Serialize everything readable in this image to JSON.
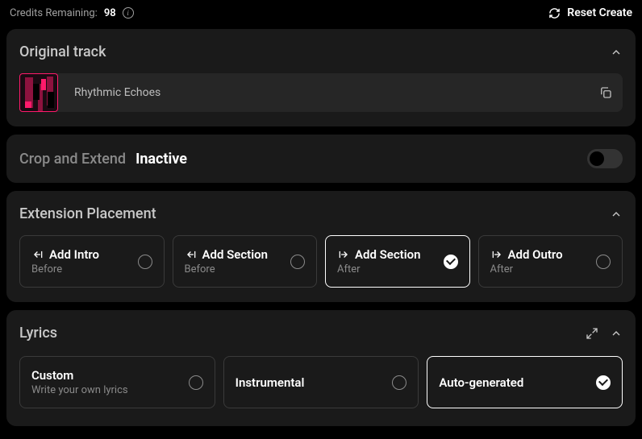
{
  "header": {
    "credits_label": "Credits Remaining:",
    "credits_value": "98",
    "reset_label": "Reset Create"
  },
  "original_track": {
    "title": "Original track",
    "track_name": "Rhythmic Echoes"
  },
  "crop_extend": {
    "label": "Crop and Extend",
    "status": "Inactive",
    "enabled": false
  },
  "extension": {
    "title": "Extension Placement",
    "options": [
      {
        "title": "Add Intro",
        "sub": "Before",
        "icon": "arrow-left-bar",
        "selected": false
      },
      {
        "title": "Add Section",
        "sub": "Before",
        "icon": "arrow-left-bar",
        "selected": false
      },
      {
        "title": "Add Section",
        "sub": "After",
        "icon": "bar-arrow-right",
        "selected": true
      },
      {
        "title": "Add Outro",
        "sub": "After",
        "icon": "bar-arrow-right",
        "selected": false
      }
    ]
  },
  "lyrics": {
    "title": "Lyrics",
    "options": [
      {
        "title": "Custom",
        "sub": "Write your own lyrics",
        "selected": false
      },
      {
        "title": "Instrumental",
        "sub": "",
        "selected": false
      },
      {
        "title": "Auto-generated",
        "sub": "",
        "selected": true
      }
    ]
  }
}
